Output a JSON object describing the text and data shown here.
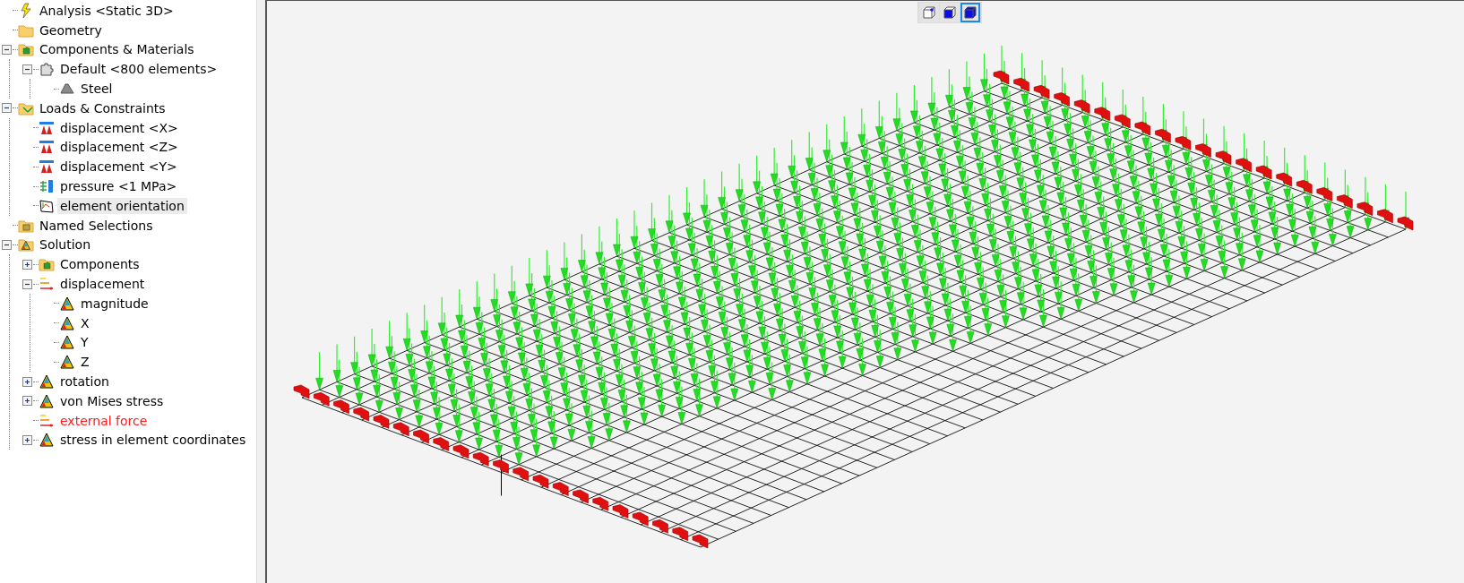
{
  "tree": [
    {
      "label": "Analysis <Static 3D>",
      "kind": "analysis",
      "selected": false,
      "error": false
    },
    {
      "label": "Geometry",
      "kind": "folder",
      "selected": false,
      "error": false
    },
    {
      "label": "Components & Materials",
      "kind": "folder-components",
      "selected": false,
      "error": false,
      "expanded": true,
      "children": [
        {
          "label": "Default <800 elements>",
          "kind": "component",
          "selected": false,
          "error": false,
          "expanded": true,
          "children": [
            {
              "label": "Steel",
              "kind": "material",
              "selected": false,
              "error": false
            }
          ]
        }
      ]
    },
    {
      "label": "Loads & Constraints",
      "kind": "folder-loads",
      "selected": false,
      "error": false,
      "expanded": true,
      "children": [
        {
          "label": "displacement <X>",
          "kind": "constraint",
          "selected": false,
          "error": false
        },
        {
          "label": "displacement <Z>",
          "kind": "constraint",
          "selected": false,
          "error": false
        },
        {
          "label": "displacement <Y>",
          "kind": "constraint",
          "selected": false,
          "error": false
        },
        {
          "label": "pressure <1 MPa>",
          "kind": "pressure",
          "selected": false,
          "error": false
        },
        {
          "label": "element orientation",
          "kind": "orientation",
          "selected": true,
          "error": false
        }
      ]
    },
    {
      "label": "Named Selections",
      "kind": "folder-selections",
      "selected": false,
      "error": false
    },
    {
      "label": "Solution",
      "kind": "folder-solution",
      "selected": false,
      "error": false,
      "expanded": true,
      "children": [
        {
          "label": "Components",
          "kind": "folder-components",
          "selected": false,
          "error": false,
          "expanded": false
        },
        {
          "label": "displacement",
          "kind": "force",
          "selected": false,
          "error": false,
          "expanded": true,
          "children": [
            {
              "label": "magnitude",
              "kind": "result",
              "selected": false,
              "error": false
            },
            {
              "label": "X",
              "kind": "result",
              "selected": false,
              "error": false
            },
            {
              "label": "Y",
              "kind": "result",
              "selected": false,
              "error": false
            },
            {
              "label": "Z",
              "kind": "result",
              "selected": false,
              "error": false
            }
          ]
        },
        {
          "label": "rotation",
          "kind": "result",
          "selected": false,
          "error": false,
          "expanded": false
        },
        {
          "label": "von Mises stress",
          "kind": "result",
          "selected": false,
          "error": false,
          "expanded": false
        },
        {
          "label": "external force",
          "kind": "force",
          "selected": false,
          "error": true
        },
        {
          "label": "stress in element coordinates",
          "kind": "result",
          "selected": false,
          "error": false,
          "expanded": false
        }
      ]
    }
  ],
  "view_buttons": [
    {
      "kind": "wireframe",
      "selected": false
    },
    {
      "kind": "face",
      "selected": false
    },
    {
      "kind": "solid",
      "selected": true
    }
  ]
}
